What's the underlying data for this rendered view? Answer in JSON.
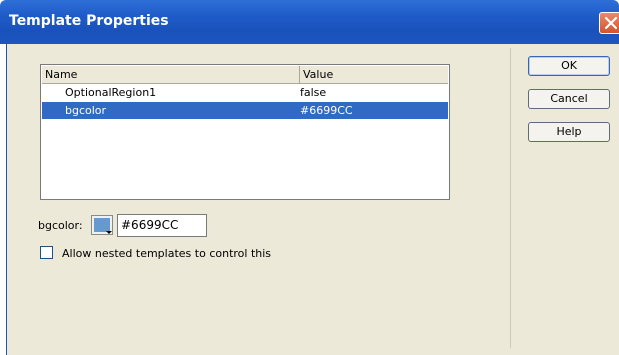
{
  "window": {
    "title": "Template Properties"
  },
  "list": {
    "columns": [
      "Name",
      "Value"
    ],
    "rows": [
      {
        "name": "OptionalRegion1",
        "value": "false",
        "selected": false
      },
      {
        "name": "bgcolor",
        "value": "#6699CC",
        "selected": true
      }
    ]
  },
  "buttons": {
    "ok": "OK",
    "cancel": "Cancel",
    "help": "Help"
  },
  "editor": {
    "label": "bgcolor:",
    "swatch_color": "#6699CC",
    "hex_value": "#6699CC"
  },
  "nested": {
    "label": "Allow nested templates to control this",
    "checked": false
  },
  "colors": {
    "selection": "#316AC5",
    "titlebar": "#1F5CC8",
    "dialog_bg": "#ECE9D8"
  }
}
